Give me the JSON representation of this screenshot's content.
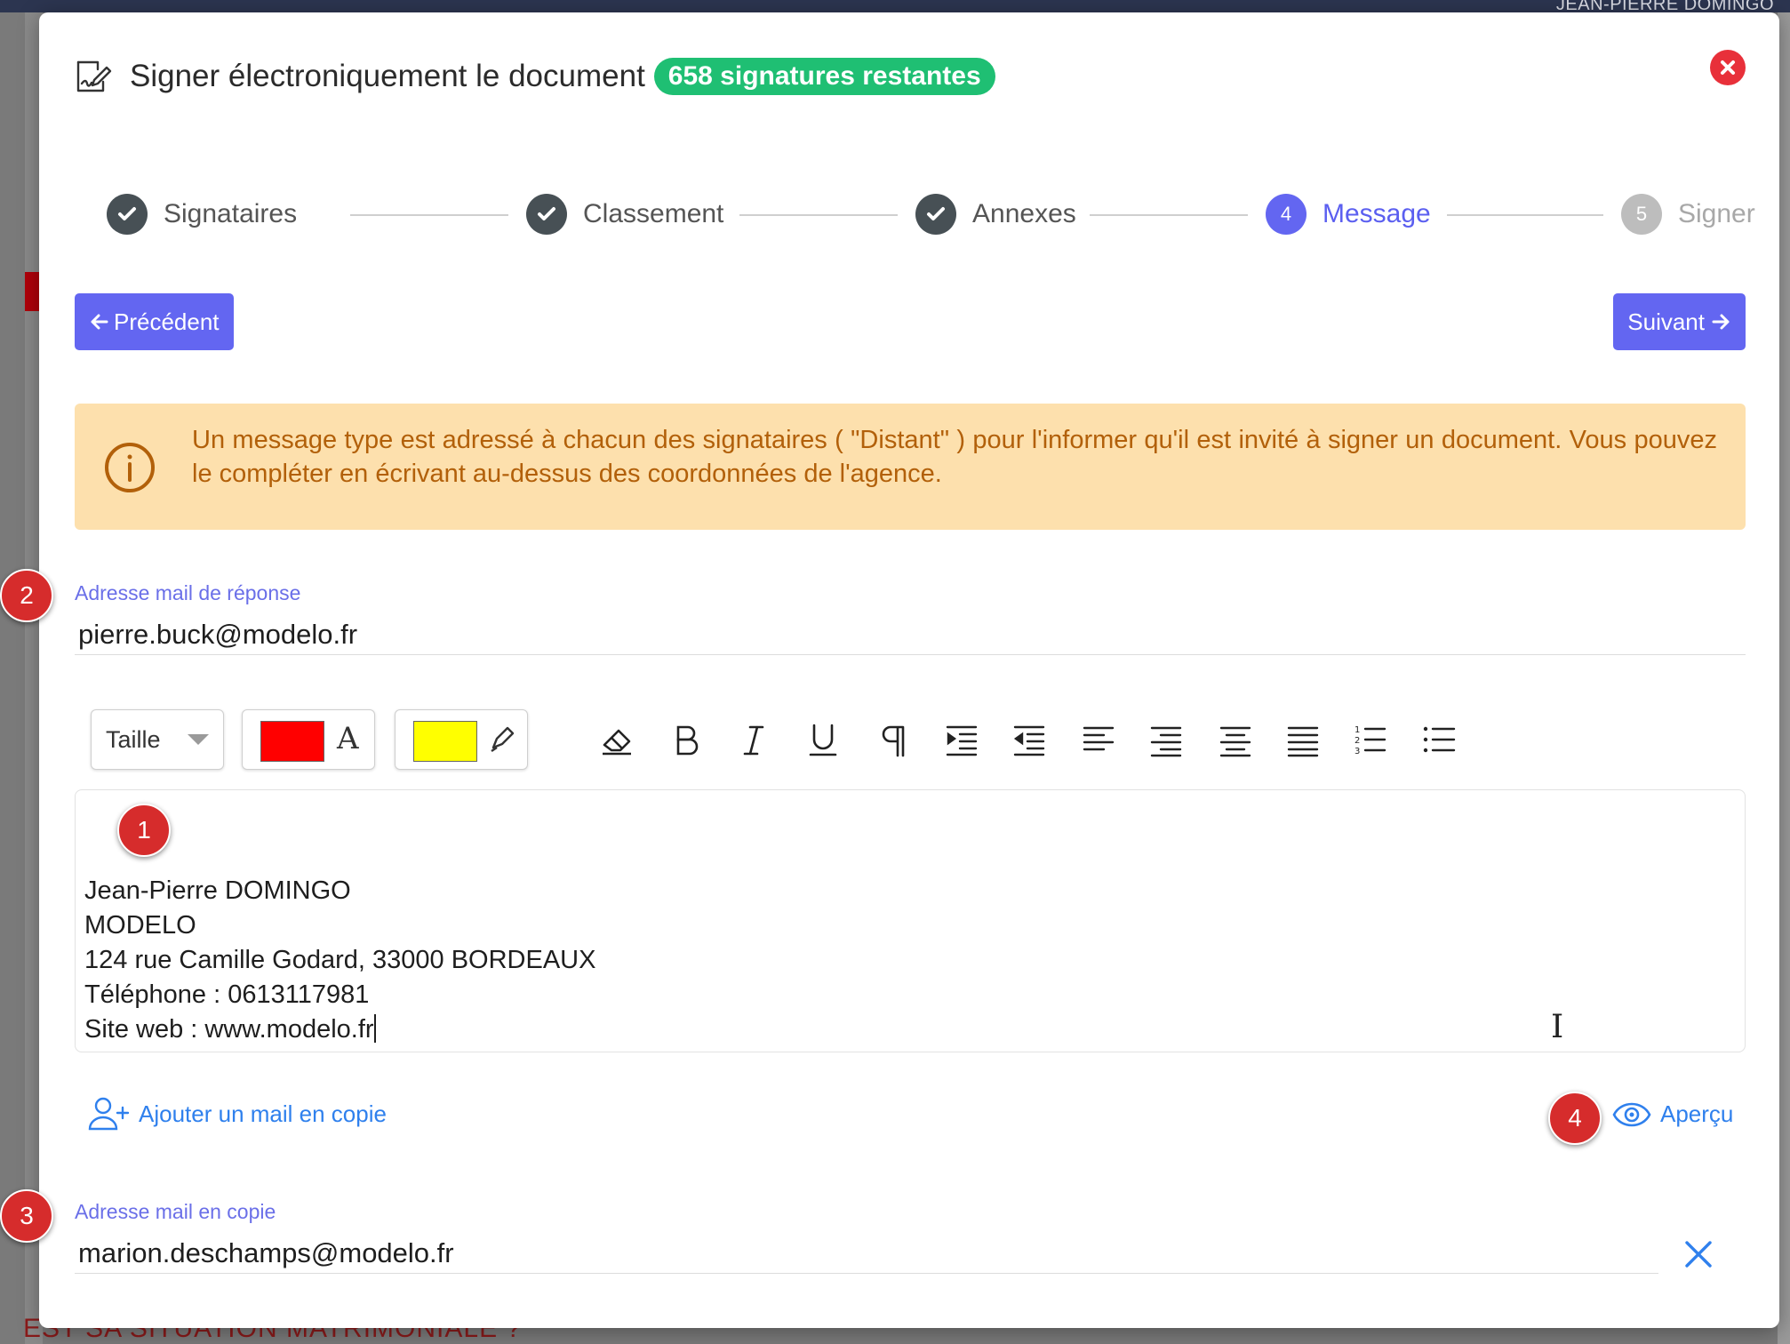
{
  "background": {
    "user_name": "JEAN-PIERRE DOMINGO",
    "bottom_text": "EST SA SITUATION MATRIMONIALE ?"
  },
  "modal": {
    "title": "Signer électroniquement le document",
    "badge": "658 signatures restantes",
    "title_icon": "sign-document-icon",
    "close_icon": "close-circle-icon"
  },
  "stepper": {
    "steps": [
      {
        "label": "Signataires",
        "state": "done"
      },
      {
        "label": "Classement",
        "state": "done"
      },
      {
        "label": "Annexes",
        "state": "done"
      },
      {
        "label": "Message",
        "state": "current",
        "number": "4"
      },
      {
        "label": "Signer",
        "state": "todo",
        "number": "5"
      }
    ]
  },
  "nav": {
    "prev_label": "Précédent",
    "next_label": "Suivant"
  },
  "alert": {
    "text": "Un message type est adressé à chacun des signataires ( \"Distant\" ) pour l'informer qu'il est invité à signer un document. Vous pouvez le compléter en écrivant au-dessus des coordonnées de l'agence."
  },
  "reply_field": {
    "label": "Adresse mail de réponse",
    "value": "pierre.buck@modelo.fr"
  },
  "toolbar": {
    "size_label": "Taille",
    "text_color": "#ff0000",
    "highlight_color": "#ffff00",
    "text_color_glyph": "A",
    "tools": [
      "eraser-icon",
      "bold-icon",
      "italic-icon",
      "underline-icon",
      "paragraph-icon",
      "indent-icon",
      "outdent-icon",
      "align-left-icon",
      "align-right-icon",
      "align-center-icon",
      "align-justify-icon",
      "ordered-list-icon",
      "bullet-list-icon"
    ]
  },
  "editor": {
    "lines": [
      "Jean-Pierre DOMINGO",
      "MODELO",
      "124 rue Camille Godard, 33000 BORDEAUX",
      "Téléphone : 0613117981",
      "Site web : www.modelo.fr"
    ]
  },
  "markers": {
    "m1": "1",
    "m2": "2",
    "m3": "3",
    "m4": "4"
  },
  "actions": {
    "add_cc_label": "Ajouter un mail en copie",
    "preview_label": "Aperçu"
  },
  "cc_field": {
    "label": "Adresse mail en copie",
    "value": "marion.deschamps@modelo.fr"
  }
}
